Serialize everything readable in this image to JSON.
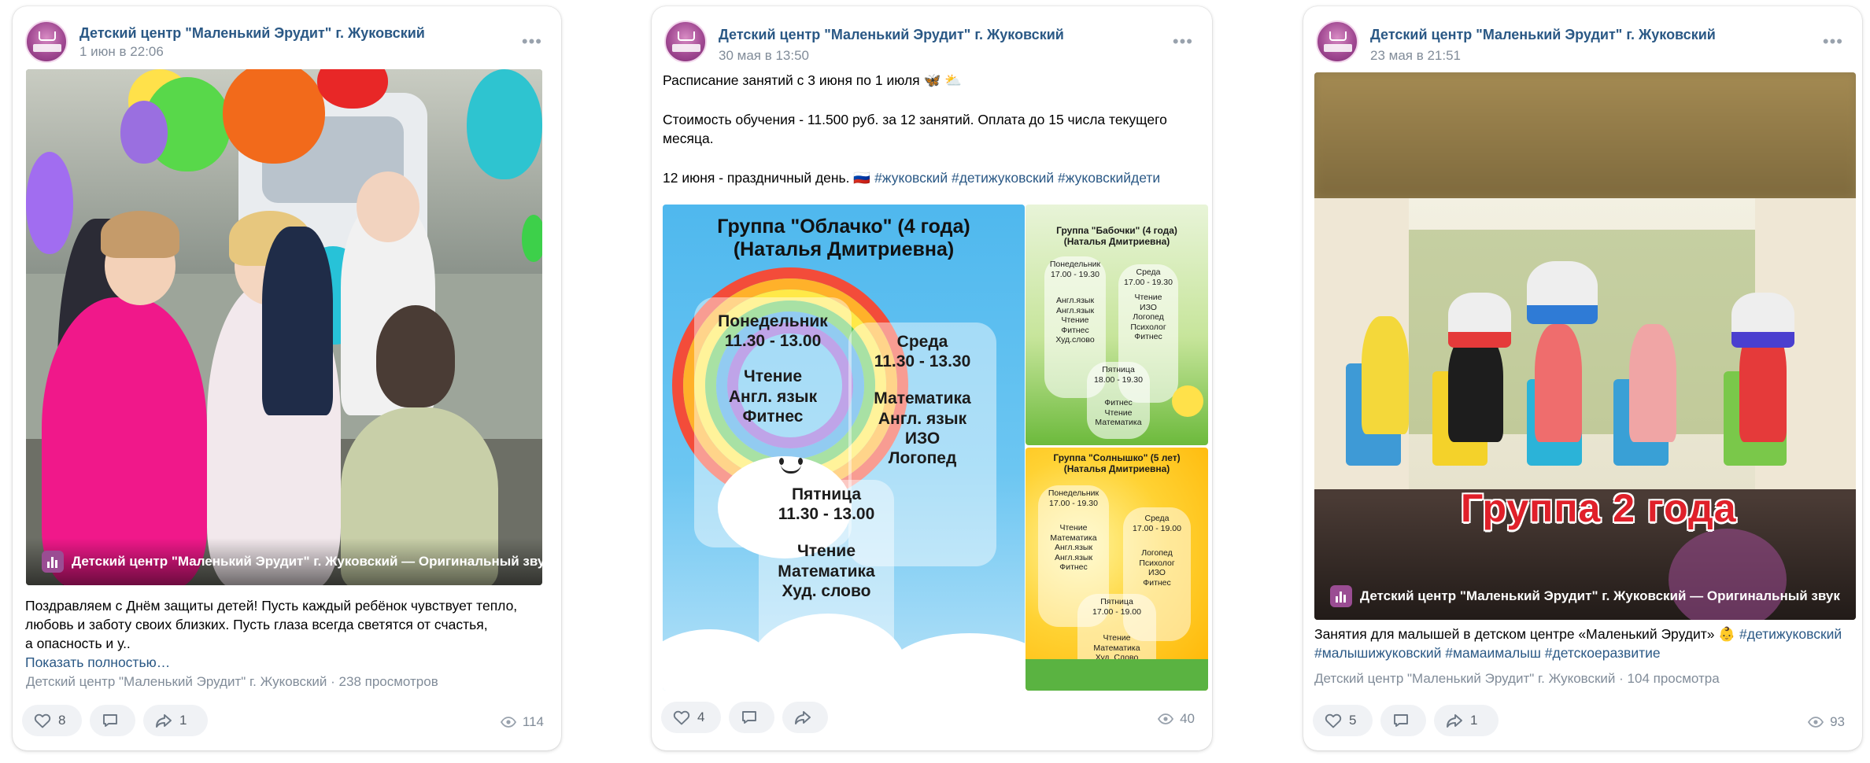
{
  "posts": [
    {
      "author": "Детский центр \"Маленький Эрудит\" г. Жуковский",
      "date": "1 июн в 22:06",
      "media_label": "Детский центр \"Маленький Эрудит\" г. Жуковский — Оригинальный звук",
      "text_lines": [
        "Поздравляем с Днём защиты детей! Пусть каждый ребёнок чувствует тепло,",
        "любовь и заботу своих близких. Пусть глаза всегда светятся от счастья,",
        "а опасность и у.."
      ],
      "show_more": "Показать полностью…",
      "stats": "Детский центр \"Маленький Эрудит\" г. Жуковский · 238 просмотров",
      "likes": "8",
      "shares": "1",
      "views": "114"
    },
    {
      "author": "Детский центр \"Маленький Эрудит\" г. Жуковский",
      "date": "30 мая в 13:50",
      "text_line1": "Расписание занятий с 3 июня по 1 июля 🦋 ⛅",
      "text_line2": "Стоимость обучения - 11.500 руб. за 12 занятий. Оплата до 15 числа текущего",
      "text_line3": "месяца.",
      "text_line4_prefix": "12 июня - праздничный день. 🇷🇺",
      "hashtags": "#жуковский #детижуковский #жуковскийдети",
      "likes": "4",
      "views": "40",
      "schedule_main": {
        "title1": "Группа \"Облачко\" (4 года)",
        "title2": "(Наталья Дмитриевна)",
        "mon_day": "Понедельник",
        "mon_time": "11.30 - 13.00",
        "mon_subj": [
          "Чтение",
          "Англ. язык",
          "Фитнес"
        ],
        "wed_day": "Среда",
        "wed_time": "11.30 - 13.30",
        "wed_subj": [
          "Математика",
          "Англ. язык",
          "ИЗО",
          "Логопед"
        ],
        "fri_day": "Пятница",
        "fri_time": "11.30 - 13.00",
        "fri_subj": [
          "Чтение",
          "Математика",
          "Худ. слово"
        ]
      },
      "schedule_b": {
        "title1": "Группа \"Бабочки\" (4 года)",
        "title2": "(Наталья Дмитриевна)",
        "mon": "Понедельник\n17.00 - 19.30",
        "mon_subj": "Англ.язык\nАнгл.язык\nЧтение\nФитнес\nХуд.слово",
        "wed": "Среда\n17.00 - 19.30",
        "wed_subj": "Чтение\nИЗО\nЛогопед\nПсихолог\nФитнес",
        "fri": "Пятница\n18.00 - 19.30",
        "fri_subj": "Фитнес\nЧтение\nМатематика"
      },
      "schedule_s": {
        "title1": "Группа \"Солнышко\" (5 лет)",
        "title2": "(Наталья Дмитриевна)",
        "mon": "Понедельник\n17.00 - 19.30",
        "mon_subj": "Чтение\nМатематика\nАнгл.язык\nАнгл.язык\nФитнес",
        "wed": "Среда\n17.00 - 19.00",
        "wed_subj": "Логопед\nПсихолог\nИЗО\nФитнес",
        "fri": "Пятница\n17.00 - 19.00",
        "fri_subj": "Чтение\nМатематика\nХуд. Слово\nФитнес"
      }
    },
    {
      "author": "Детский центр \"Маленький Эрудит\" г. Жуковский",
      "date": "23 мая в 21:51",
      "video_caption": "Группа 2 года",
      "media_label": "Детский центр \"Маленький Эрудит\" г. Жуковский — Оригинальный звук",
      "text_prefix": "Занятия для малышей в детском центре «Маленький Эрудит» 👶",
      "hashtags_line1": "#детижуковский",
      "hashtags_line2": "#малышижуковский #мамаималыш #детскоеразвитие",
      "stats": "Детский центр \"Маленький Эрудит\" г. Жуковский · 104 просмотра",
      "likes": "5",
      "shares": "1",
      "views": "93"
    }
  ],
  "colors": {
    "link": "#2a5885",
    "meta": "#818c99",
    "brand": "#9a4d93"
  }
}
